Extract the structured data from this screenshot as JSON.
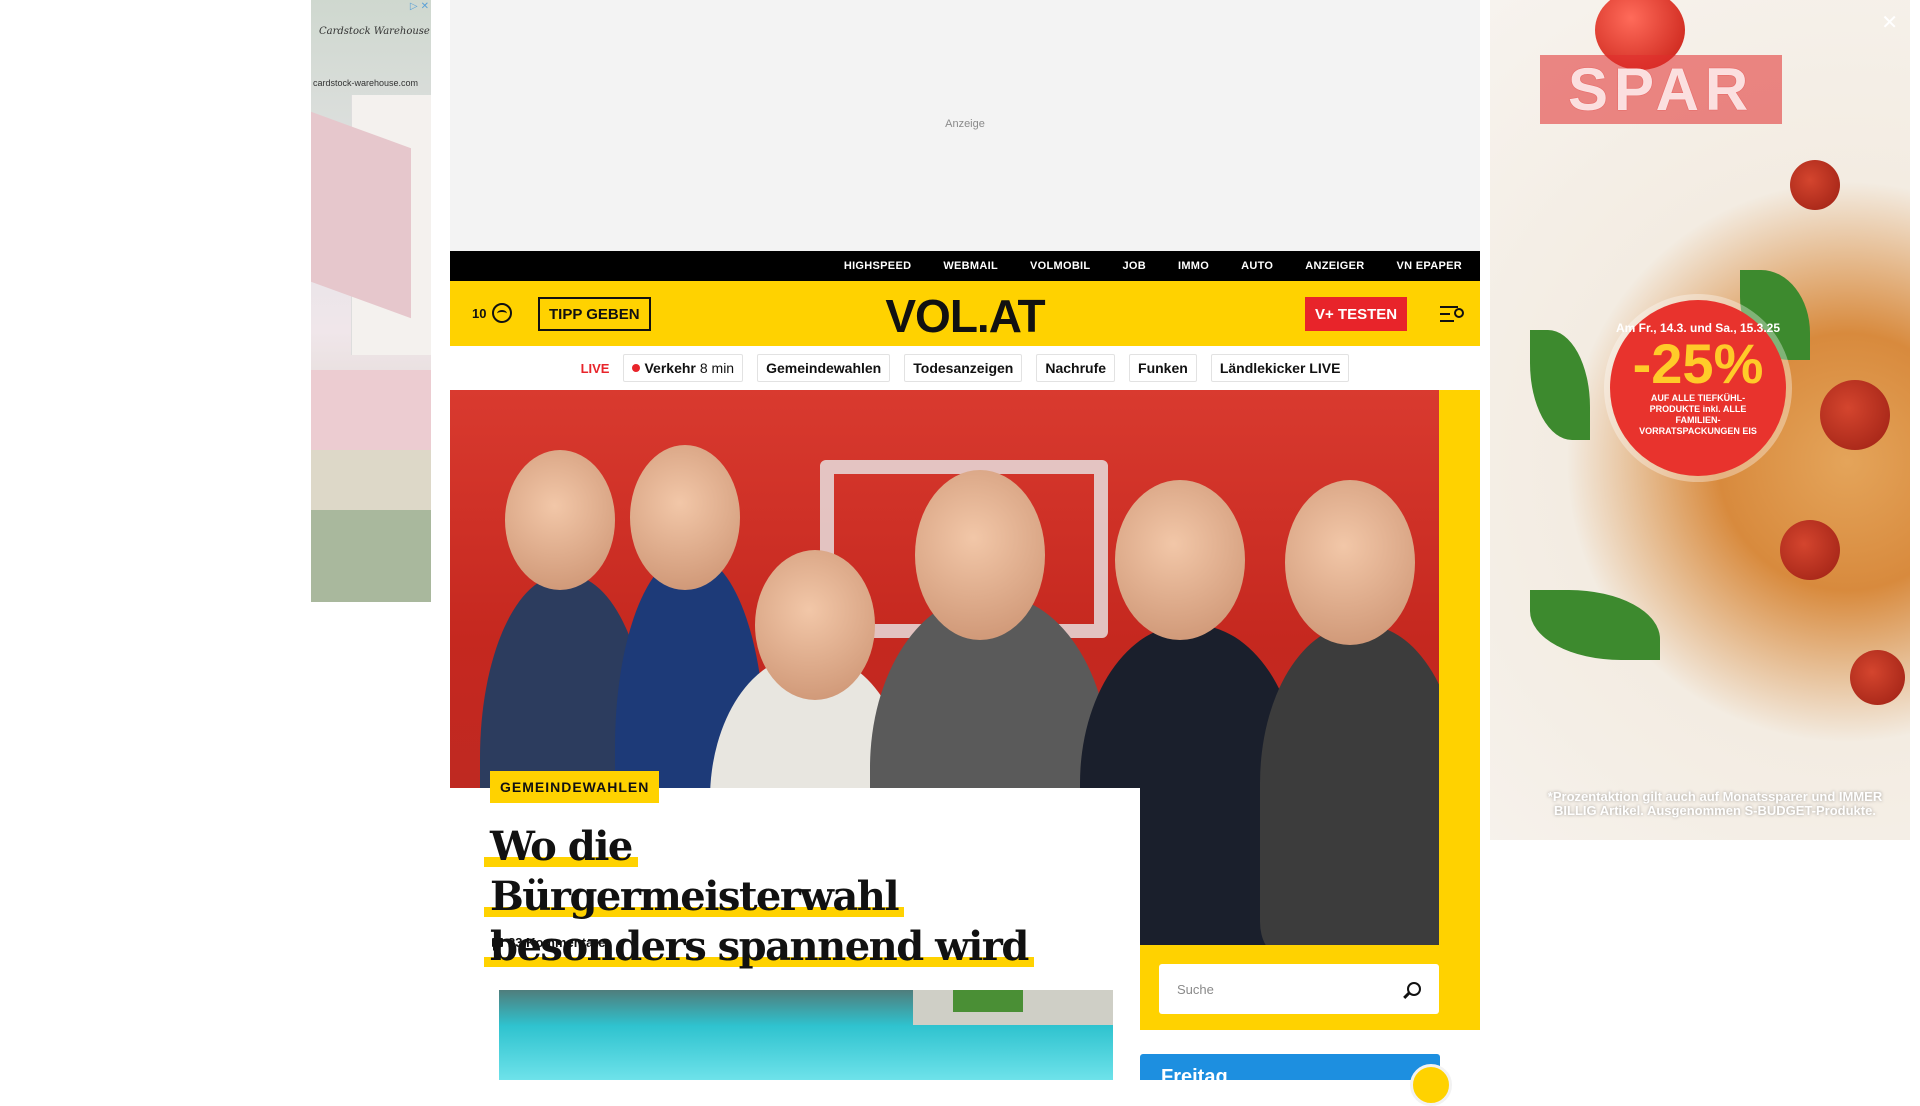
{
  "ads": {
    "left": {
      "brand": "Cardstock Warehouse",
      "url": "cardstock-warehouse.com"
    },
    "top": {
      "label": "Anzeige"
    },
    "right": {
      "brand": "SPAR",
      "promo_date": "Am Fr., 14.3. und Sa., 15.3.25",
      "promo_percent": "-25%",
      "promo_text": "AUF ALLE TIEFKÜHL-PRODUKTE inkl. ALLE FAMILIEN-VORRATSPACKUNGEN EIS",
      "footnote": "*Prozentaktion gilt auch auf Monatssparer und IMMER BILLIG Artikel. Ausgenommen S-BUDGET-Produkte.",
      "close": "✕"
    }
  },
  "topbar": {
    "links": [
      "HIGHSPEED",
      "WEBMAIL",
      "VOLMOBIL",
      "JOB",
      "IMMO",
      "AUTO",
      "ANZEIGER",
      "VN EPAPER"
    ]
  },
  "header": {
    "temperature": "10",
    "tip_button": "TIPP GEBEN",
    "logo": "VOL.AT",
    "vplus_button": "V+ TESTEN"
  },
  "quicknav": {
    "live_label": "LIVE",
    "traffic_label": "Verkehr",
    "traffic_time": "8 min",
    "chips": [
      "Gemeindewahlen",
      "Todesanzeigen",
      "Nachrufe",
      "Funken",
      "Ländlekicker LIVE"
    ]
  },
  "article": {
    "category": "GEMEINDEWAHLEN",
    "headline_line1": "Wo die Bürgermeisterwahl",
    "headline_line2": "besonders spannend wird",
    "comments": "23 Kommentare"
  },
  "sidebar": {
    "search_placeholder": "Suche",
    "card_title": "Freitag"
  },
  "colors": {
    "brand_yellow": "#ffd200",
    "accent_red": "#e8242a",
    "topbar_black": "#000000",
    "card_blue": "#1d8fe0"
  }
}
